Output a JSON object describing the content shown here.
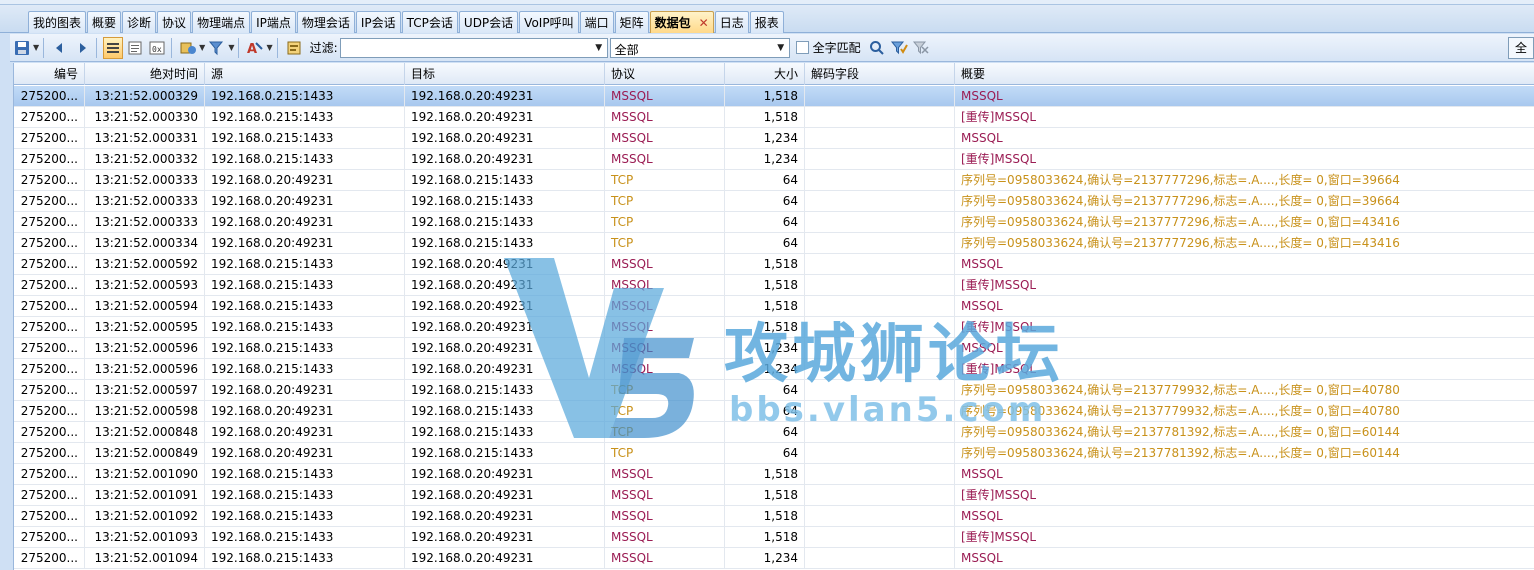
{
  "tabs": [
    {
      "label": "我的图表",
      "active": false
    },
    {
      "label": "概要",
      "active": false
    },
    {
      "label": "诊断",
      "active": false
    },
    {
      "label": "协议",
      "active": false
    },
    {
      "label": "物理端点",
      "active": false
    },
    {
      "label": "IP端点",
      "active": false
    },
    {
      "label": "物理会话",
      "active": false
    },
    {
      "label": "IP会话",
      "active": false
    },
    {
      "label": "TCP会话",
      "active": false
    },
    {
      "label": "UDP会话",
      "active": false
    },
    {
      "label": "VoIP呼叫",
      "active": false
    },
    {
      "label": "端口",
      "active": false
    },
    {
      "label": "矩阵",
      "active": false
    },
    {
      "label": "数据包",
      "active": true,
      "close": "✕"
    },
    {
      "label": "日志",
      "active": false
    },
    {
      "label": "报表",
      "active": false
    }
  ],
  "toolbar": {
    "filter_label": "过滤:",
    "filter_value": "",
    "scope_value": "全部",
    "fullmatch_label": "全字匹配",
    "fullmatch_checked": false,
    "right_button_label": "全部"
  },
  "columns": [
    {
      "key": "id",
      "label": "编号"
    },
    {
      "key": "time",
      "label": "绝对时间"
    },
    {
      "key": "src",
      "label": "源"
    },
    {
      "key": "dst",
      "label": "目标"
    },
    {
      "key": "proto",
      "label": "协议"
    },
    {
      "key": "size",
      "label": "大小"
    },
    {
      "key": "decode",
      "label": "解码字段"
    },
    {
      "key": "summary",
      "label": "概要"
    }
  ],
  "colors": {
    "mssql": "#9b1d54",
    "tcp": "#c8911a",
    "selected": "#a8c8ee"
  },
  "rows": [
    {
      "id": "275200...",
      "time": "13:21:52.000329",
      "src": "192.168.0.215:1433",
      "dst": "192.168.0.20:49231",
      "proto": "MSSQL",
      "size": "1,518",
      "decode": "",
      "summary": "MSSQL",
      "selected": true
    },
    {
      "id": "275200...",
      "time": "13:21:52.000330",
      "src": "192.168.0.215:1433",
      "dst": "192.168.0.20:49231",
      "proto": "MSSQL",
      "size": "1,518",
      "decode": "",
      "summary": "[重传]MSSQL"
    },
    {
      "id": "275200...",
      "time": "13:21:52.000331",
      "src": "192.168.0.215:1433",
      "dst": "192.168.0.20:49231",
      "proto": "MSSQL",
      "size": "1,234",
      "decode": "",
      "summary": "MSSQL"
    },
    {
      "id": "275200...",
      "time": "13:21:52.000332",
      "src": "192.168.0.215:1433",
      "dst": "192.168.0.20:49231",
      "proto": "MSSQL",
      "size": "1,234",
      "decode": "",
      "summary": "[重传]MSSQL"
    },
    {
      "id": "275200...",
      "time": "13:21:52.000333",
      "src": "192.168.0.20:49231",
      "dst": "192.168.0.215:1433",
      "proto": "TCP",
      "size": "64",
      "decode": "",
      "summary": "序列号=0958033624,确认号=2137777296,标志=.A....,长度=    0,窗口=39664"
    },
    {
      "id": "275200...",
      "time": "13:21:52.000333",
      "src": "192.168.0.20:49231",
      "dst": "192.168.0.215:1433",
      "proto": "TCP",
      "size": "64",
      "decode": "",
      "summary": "序列号=0958033624,确认号=2137777296,标志=.A....,长度=    0,窗口=39664"
    },
    {
      "id": "275200...",
      "time": "13:21:52.000333",
      "src": "192.168.0.20:49231",
      "dst": "192.168.0.215:1433",
      "proto": "TCP",
      "size": "64",
      "decode": "",
      "summary": "序列号=0958033624,确认号=2137777296,标志=.A....,长度=    0,窗口=43416"
    },
    {
      "id": "275200...",
      "time": "13:21:52.000334",
      "src": "192.168.0.20:49231",
      "dst": "192.168.0.215:1433",
      "proto": "TCP",
      "size": "64",
      "decode": "",
      "summary": "序列号=0958033624,确认号=2137777296,标志=.A....,长度=    0,窗口=43416"
    },
    {
      "id": "275200...",
      "time": "13:21:52.000592",
      "src": "192.168.0.215:1433",
      "dst": "192.168.0.20:49231",
      "proto": "MSSQL",
      "size": "1,518",
      "decode": "",
      "summary": "MSSQL"
    },
    {
      "id": "275200...",
      "time": "13:21:52.000593",
      "src": "192.168.0.215:1433",
      "dst": "192.168.0.20:49231",
      "proto": "MSSQL",
      "size": "1,518",
      "decode": "",
      "summary": "[重传]MSSQL"
    },
    {
      "id": "275200...",
      "time": "13:21:52.000594",
      "src": "192.168.0.215:1433",
      "dst": "192.168.0.20:49231",
      "proto": "MSSQL",
      "size": "1,518",
      "decode": "",
      "summary": "MSSQL"
    },
    {
      "id": "275200...",
      "time": "13:21:52.000595",
      "src": "192.168.0.215:1433",
      "dst": "192.168.0.20:49231",
      "proto": "MSSQL",
      "size": "1,518",
      "decode": "",
      "summary": "[重传]MSSQL"
    },
    {
      "id": "275200...",
      "time": "13:21:52.000596",
      "src": "192.168.0.215:1433",
      "dst": "192.168.0.20:49231",
      "proto": "MSSQL",
      "size": "1,234",
      "decode": "",
      "summary": "MSSQL"
    },
    {
      "id": "275200...",
      "time": "13:21:52.000596",
      "src": "192.168.0.215:1433",
      "dst": "192.168.0.20:49231",
      "proto": "MSSQL",
      "size": "1,234",
      "decode": "",
      "summary": "[重传]MSSQL"
    },
    {
      "id": "275200...",
      "time": "13:21:52.000597",
      "src": "192.168.0.20:49231",
      "dst": "192.168.0.215:1433",
      "proto": "TCP",
      "size": "64",
      "decode": "",
      "summary": "序列号=0958033624,确认号=2137779932,标志=.A....,长度=    0,窗口=40780"
    },
    {
      "id": "275200...",
      "time": "13:21:52.000598",
      "src": "192.168.0.20:49231",
      "dst": "192.168.0.215:1433",
      "proto": "TCP",
      "size": "64",
      "decode": "",
      "summary": "序列号=0958033624,确认号=2137779932,标志=.A....,长度=    0,窗口=40780"
    },
    {
      "id": "275200...",
      "time": "13:21:52.000848",
      "src": "192.168.0.20:49231",
      "dst": "192.168.0.215:1433",
      "proto": "TCP",
      "size": "64",
      "decode": "",
      "summary": "序列号=0958033624,确认号=2137781392,标志=.A....,长度=    0,窗口=60144"
    },
    {
      "id": "275200...",
      "time": "13:21:52.000849",
      "src": "192.168.0.20:49231",
      "dst": "192.168.0.215:1433",
      "proto": "TCP",
      "size": "64",
      "decode": "",
      "summary": "序列号=0958033624,确认号=2137781392,标志=.A....,长度=    0,窗口=60144"
    },
    {
      "id": "275200...",
      "time": "13:21:52.001090",
      "src": "192.168.0.215:1433",
      "dst": "192.168.0.20:49231",
      "proto": "MSSQL",
      "size": "1,518",
      "decode": "",
      "summary": "MSSQL"
    },
    {
      "id": "275200...",
      "time": "13:21:52.001091",
      "src": "192.168.0.215:1433",
      "dst": "192.168.0.20:49231",
      "proto": "MSSQL",
      "size": "1,518",
      "decode": "",
      "summary": "[重传]MSSQL"
    },
    {
      "id": "275200...",
      "time": "13:21:52.001092",
      "src": "192.168.0.215:1433",
      "dst": "192.168.0.20:49231",
      "proto": "MSSQL",
      "size": "1,518",
      "decode": "",
      "summary": "MSSQL"
    },
    {
      "id": "275200...",
      "time": "13:21:52.001093",
      "src": "192.168.0.215:1433",
      "dst": "192.168.0.20:49231",
      "proto": "MSSQL",
      "size": "1,518",
      "decode": "",
      "summary": "[重传]MSSQL"
    },
    {
      "id": "275200...",
      "time": "13:21:52.001094",
      "src": "192.168.0.215:1433",
      "dst": "192.168.0.20:49231",
      "proto": "MSSQL",
      "size": "1,234",
      "decode": "",
      "summary": "MSSQL"
    }
  ],
  "watermark": {
    "title": "攻城狮论坛",
    "url": "bbs.vlan5.com"
  }
}
